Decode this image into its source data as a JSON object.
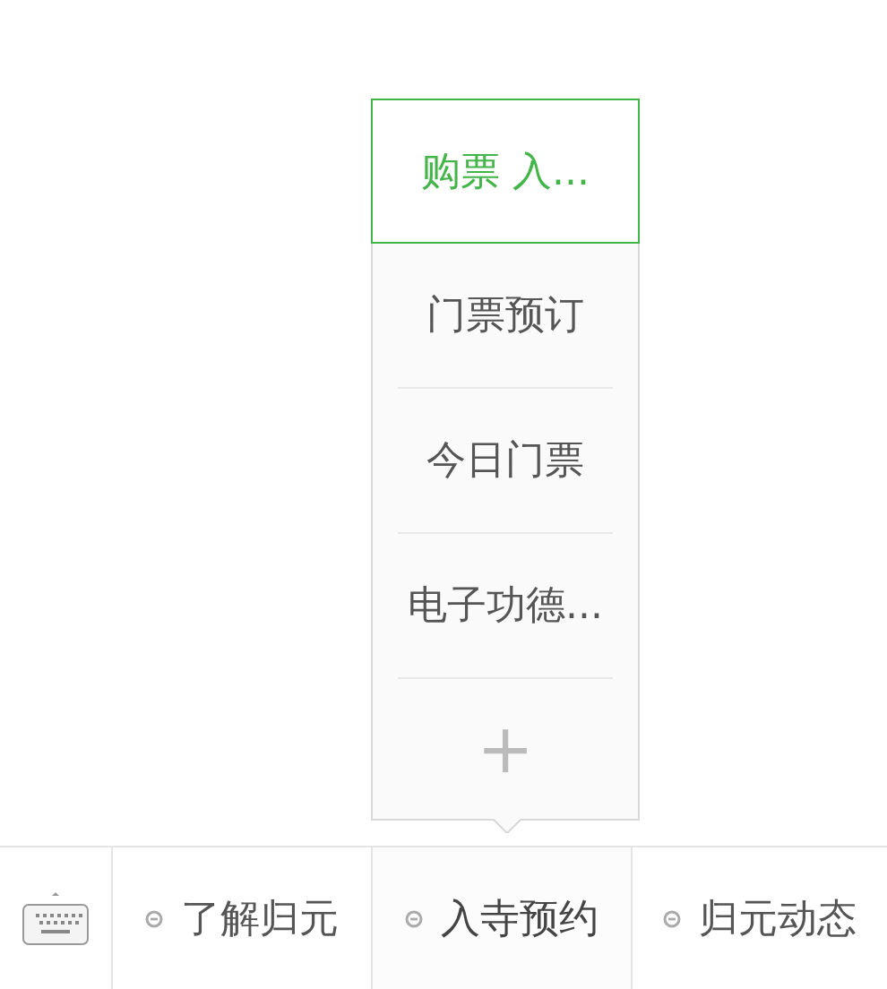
{
  "submenu": {
    "items": [
      {
        "label": "购票 入...",
        "selected": true
      },
      {
        "label": "门票预订",
        "selected": false
      },
      {
        "label": "今日门票",
        "selected": false
      },
      {
        "label": "电子功德...",
        "selected": false
      }
    ],
    "add_button": "+"
  },
  "menu_bar": {
    "items": [
      {
        "label": "了解归元",
        "selected": false
      },
      {
        "label": "入寺预约",
        "selected": true
      },
      {
        "label": "归元动态",
        "selected": false
      }
    ]
  }
}
